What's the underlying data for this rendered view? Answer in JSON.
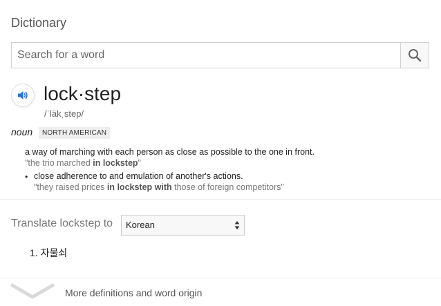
{
  "panel": {
    "title": "Dictionary"
  },
  "search": {
    "placeholder": "Search for a word",
    "value": ""
  },
  "icons": {
    "search": "search-icon",
    "speaker": "speaker-icon",
    "chevron": "chevron-down-icon",
    "select_arrows": "up-down-arrows-icon"
  },
  "entry": {
    "headword": "lock·step",
    "phonetic": "/ˈläkˌstep/",
    "part_of_speech": "noun",
    "region_label": "NORTH AMERICAN",
    "definitions": [
      {
        "text": "a way of marching with each person as close as possible to the one in front.",
        "example_pre": "\"the trio marched ",
        "example_bold": "in lockstep",
        "example_post": "\""
      },
      {
        "bullet": "•",
        "text": "close adherence to and emulation of another's actions.",
        "example_pre": "\"they raised prices ",
        "example_bold": "in lockstep with",
        "example_post": " those of foreign competitors\""
      }
    ]
  },
  "translate": {
    "label": "Translate lockstep to",
    "selected_language": "Korean",
    "results": [
      {
        "text": "1. 자물쇠"
      }
    ]
  },
  "footer": {
    "more_label": "More definitions and word origin"
  },
  "colors": {
    "accent_blue": "#1a73e8",
    "divider": "#ebebeb"
  }
}
